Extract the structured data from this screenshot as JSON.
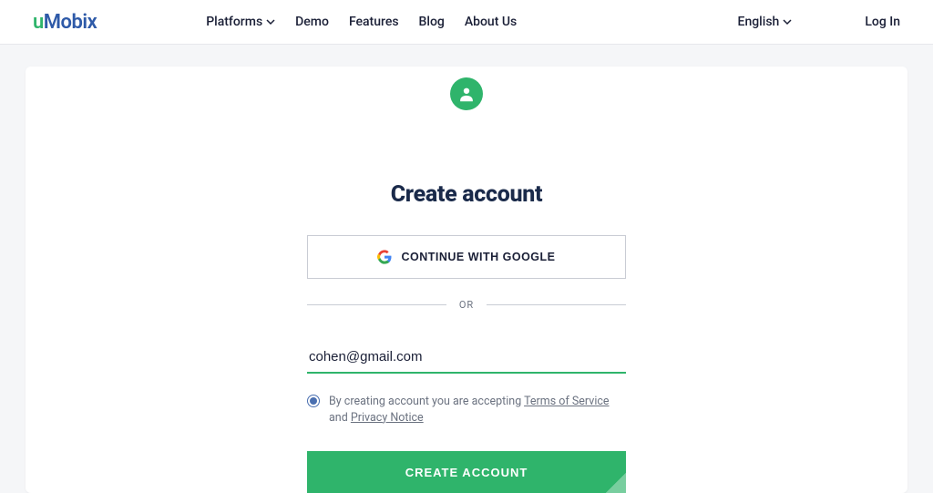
{
  "logo": {
    "u": "u",
    "rest": "Mobix"
  },
  "nav": {
    "platforms": "Platforms",
    "demo": "Demo",
    "features": "Features",
    "blog": "Blog",
    "about": "About Us"
  },
  "lang": "English",
  "login": "Log In",
  "form": {
    "title": "Create account",
    "google_label": "CONTINUE WITH GOOGLE",
    "or_label": "OR",
    "email_value": "cohen@gmail.com",
    "terms_pre": "By creating account you are accepting ",
    "terms_link": "Terms of Service",
    "terms_mid": " and ",
    "privacy_link": "Privacy Notice",
    "submit_label": "CREATE ACCOUNT"
  }
}
